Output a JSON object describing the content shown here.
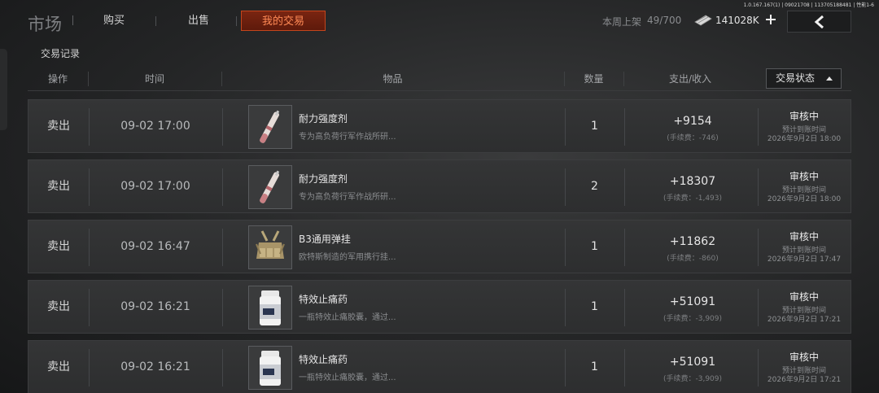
{
  "build_info": "1.0.167.167(1) | 09021708 | 113705188481 | 性能1-6",
  "topbar": {
    "title": "市场",
    "tabs": [
      {
        "label": "购买",
        "active": false
      },
      {
        "label": "出售",
        "active": false
      },
      {
        "label": "我的交易",
        "active": true
      }
    ],
    "weekly_listing_label": "本周上架",
    "weekly_listing_value": "49/700",
    "currency_icon": "banknote-icon",
    "currency_value": "141028K",
    "add_currency_icon": "plus-icon",
    "back_icon": "chevron-left-icon",
    "accent_color": "#c4451c"
  },
  "records": {
    "section_title": "交易记录",
    "columns": {
      "operation": "操作",
      "time": "时间",
      "item": "物品",
      "quantity": "数量",
      "amount": "支出/收入",
      "status": "交易状态"
    },
    "status_sort_icon": "caret-up-icon",
    "rows": [
      {
        "operation": "卖出",
        "time": "09-02 17:00",
        "item_icon": "injector-syringe-icon",
        "item_name": "耐力强度剂",
        "item_desc": "专为高负荷行军作战所研...",
        "quantity": "1",
        "amount": "+9154",
        "fee": "(手续费：-746)",
        "status": "审核中",
        "eta_label": "预计到账时间",
        "eta": "2026年9月2日 18:00"
      },
      {
        "operation": "卖出",
        "time": "09-02 17:00",
        "item_icon": "injector-syringe-icon",
        "item_name": "耐力强度剂",
        "item_desc": "专为高负荷行军作战所研...",
        "quantity": "2",
        "amount": "+18307",
        "fee": "(手续费：-1,493)",
        "status": "审核中",
        "eta_label": "预计到账时间",
        "eta": "2026年9月2日 18:00"
      },
      {
        "operation": "卖出",
        "time": "09-02 16:47",
        "item_icon": "chest-rig-icon",
        "item_name": "B3通用弹挂",
        "item_desc": "欧特斯制造的军用携行挂...",
        "quantity": "1",
        "amount": "+11862",
        "fee": "(手续费：-860)",
        "status": "审核中",
        "eta_label": "预计到账时间",
        "eta": "2026年9月2日 17:47"
      },
      {
        "operation": "卖出",
        "time": "09-02 16:21",
        "item_icon": "pill-bottle-icon",
        "item_name": "特效止痛药",
        "item_desc": "一瓶特效止痛胶囊，通过...",
        "quantity": "1",
        "amount": "+51091",
        "fee": "(手续费：-3,909)",
        "status": "审核中",
        "eta_label": "预计到账时间",
        "eta": "2026年9月2日 17:21"
      },
      {
        "operation": "卖出",
        "time": "09-02 16:21",
        "item_icon": "pill-bottle-icon",
        "item_name": "特效止痛药",
        "item_desc": "一瓶特效止痛胶囊，通过...",
        "quantity": "1",
        "amount": "+51091",
        "fee": "(手续费：-3,909)",
        "status": "审核中",
        "eta_label": "预计到账时间",
        "eta": "2026年9月2日 17:21"
      }
    ]
  }
}
